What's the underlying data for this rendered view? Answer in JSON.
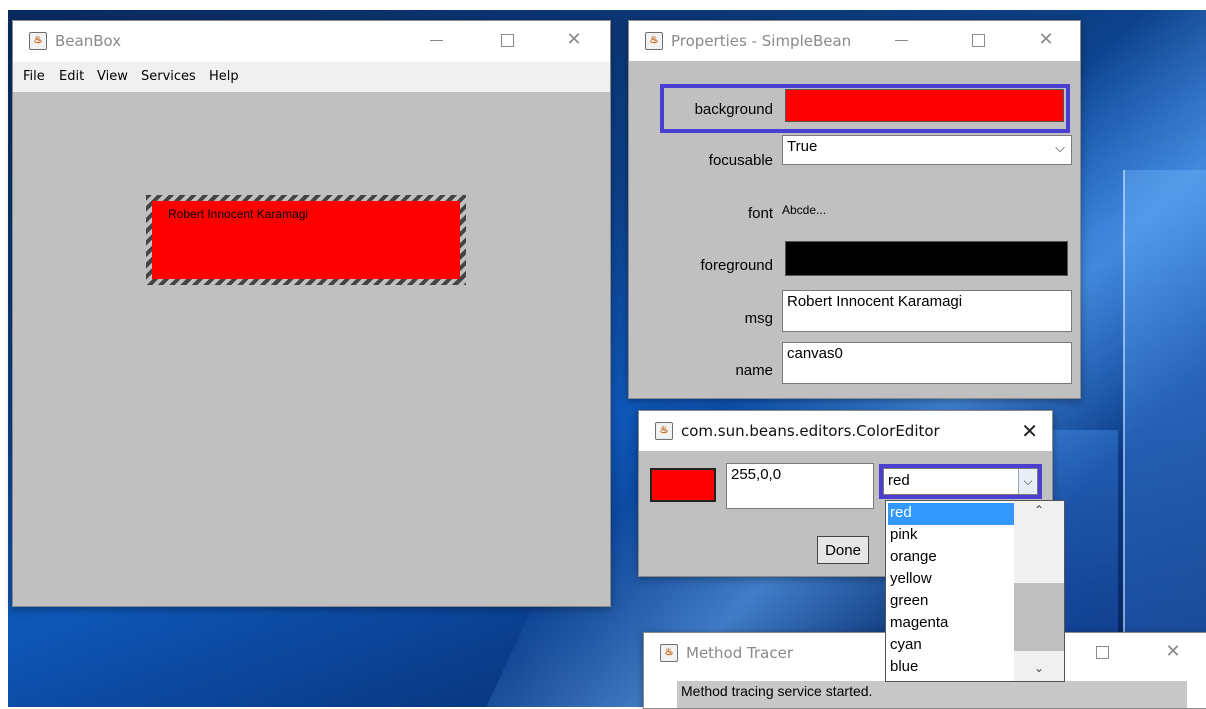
{
  "beanbox": {
    "title": "BeanBox",
    "menu": [
      "File",
      "Edit",
      "View",
      "Services",
      "Help"
    ],
    "bean_text": "Robert Innocent Karamagi"
  },
  "properties": {
    "title": "Properties - SimpleBean",
    "rows": {
      "background": {
        "label": "background",
        "color": "#ff0000"
      },
      "focusable": {
        "label": "focusable",
        "value": "True"
      },
      "font": {
        "label": "font",
        "value": "Abcde..."
      },
      "foreground": {
        "label": "foreground",
        "color": "#000000"
      },
      "msg": {
        "label": "msg",
        "value": "Robert Innocent Karamagi"
      },
      "name": {
        "label": "name",
        "value": "canvas0"
      }
    }
  },
  "color_editor": {
    "title": "com.sun.beans.editors.ColorEditor",
    "swatch_color": "#ff0000",
    "rgb_value": "255,0,0",
    "selected": "red",
    "done_label": "Done",
    "options": [
      "red",
      "pink",
      "orange",
      "yellow",
      "green",
      "magenta",
      "cyan",
      "blue"
    ]
  },
  "method_tracer": {
    "title": "Method Tracer",
    "status": "Method tracing service started."
  },
  "icons": {
    "java": "java-cup-icon",
    "minimize": "minimize-icon",
    "maximize": "maximize-icon",
    "close": "close-icon",
    "dropdown": "chevron-down-icon"
  },
  "colors": {
    "highlight": "#4a3fd0",
    "selection": "#3399ff"
  }
}
